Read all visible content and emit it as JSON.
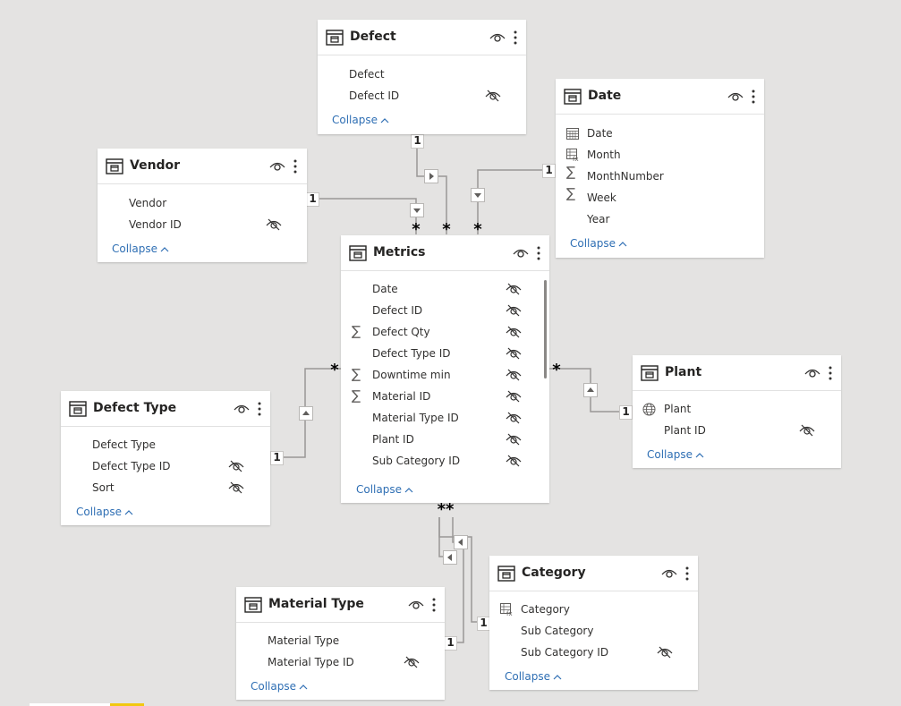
{
  "colors": {
    "canvas": "#e4e3e2",
    "card": "#ffffff",
    "link": "#2f6fb4",
    "line": "#9a9896"
  },
  "tables": {
    "defect": {
      "title": "Defect",
      "fields": [
        "Defect",
        "Defect ID"
      ],
      "collapse": "Collapse"
    },
    "date": {
      "title": "Date",
      "fields": [
        "Date",
        "Month",
        "MonthNumber",
        "Week",
        "Year"
      ],
      "collapse": "Collapse"
    },
    "vendor": {
      "title": "Vendor",
      "fields": [
        "Vendor",
        "Vendor ID"
      ],
      "collapse": "Collapse"
    },
    "metrics": {
      "title": "Metrics",
      "fields": [
        "Date",
        "Defect ID",
        "Defect Qty",
        "Defect Type ID",
        "Downtime min",
        "Material ID",
        "Material Type ID",
        "Plant ID",
        "Sub Category ID"
      ],
      "collapse": "Collapse"
    },
    "plant": {
      "title": "Plant",
      "fields": [
        "Plant",
        "Plant ID"
      ],
      "collapse": "Collapse"
    },
    "defect_type": {
      "title": "Defect Type",
      "fields": [
        "Defect Type",
        "Defect Type ID",
        "Sort"
      ],
      "collapse": "Collapse"
    },
    "category": {
      "title": "Category",
      "fields": [
        "Category",
        "Sub Category",
        "Sub Category ID"
      ],
      "collapse": "Collapse"
    },
    "material_type": {
      "title": "Material Type",
      "fields": [
        "Material Type",
        "Material Type ID"
      ],
      "collapse": "Collapse"
    }
  },
  "relationships": {
    "one": "1",
    "many": "*",
    "many_pair": "**"
  }
}
